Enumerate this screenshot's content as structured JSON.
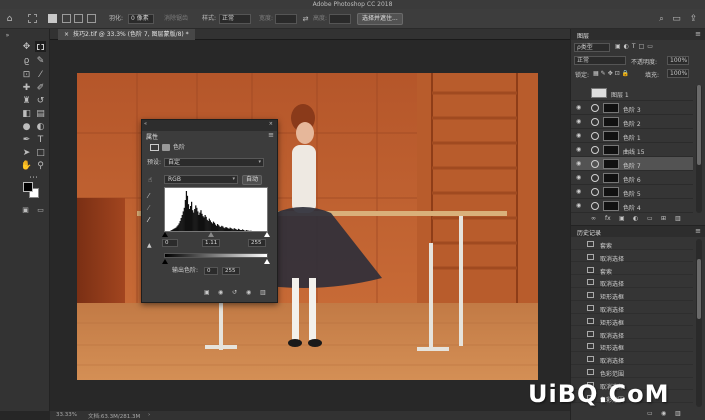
{
  "app": {
    "title": "Adobe Photoshop CC 2018"
  },
  "options_bar": {
    "feather_label": "羽化:",
    "feather_value": "0 像素",
    "antialias_label": "消除锯齿",
    "style_label": "样式:",
    "style_value": "正常",
    "width_label": "宽度:",
    "height_label": "高度:",
    "select_mask_button": "选择并遮住..."
  },
  "document": {
    "tab_title": "技巧2.tif @ 33.3% (色阶 7, 图层蒙版/8) *"
  },
  "status_bar": {
    "zoom": "33.33%",
    "doc_info": "文档:63.3M/281.3M"
  },
  "properties": {
    "title": "属性",
    "adjustment_name": "色阶",
    "preset_label": "预设:",
    "preset_value": "自定",
    "channel_value": "RGB",
    "auto_button": "自动",
    "input_black": "0",
    "input_gamma": "1.11",
    "input_white": "255",
    "output_label": "输出色阶:",
    "output_black": "0",
    "output_white": "255",
    "histogram": [
      1,
      1,
      2,
      2,
      3,
      4,
      5,
      6,
      7,
      8,
      9,
      11,
      13,
      16,
      20,
      25,
      30,
      36,
      42,
      55,
      70,
      62,
      48,
      40,
      45,
      52,
      38,
      34,
      40,
      46,
      42,
      36,
      30,
      34,
      38,
      32,
      28,
      26,
      30,
      27,
      22,
      20,
      24,
      21,
      18,
      16,
      19,
      17,
      14,
      12,
      15,
      13,
      11,
      10,
      12,
      11,
      9,
      8,
      10,
      9,
      8,
      7,
      9,
      8,
      7,
      6,
      8,
      7,
      6,
      5,
      7,
      6,
      5,
      5,
      6,
      5,
      4,
      4,
      5,
      4,
      4,
      3,
      4,
      3,
      3,
      3,
      3,
      2,
      3,
      2,
      2,
      2,
      2,
      2,
      1,
      2,
      1,
      1,
      1,
      1
    ]
  },
  "layers": {
    "title": "图层",
    "kind_label": "ρ类型",
    "blend_mode": "正常",
    "opacity_label": "不透明度:",
    "opacity_value": "100%",
    "lock_label": "锁定:",
    "fill_label": "填充:",
    "fill_value": "100%",
    "group_name": "图层 1",
    "items": [
      {
        "name": "色阶 3"
      },
      {
        "name": "色阶 2"
      },
      {
        "name": "色阶 1"
      },
      {
        "name": "曲线 15"
      },
      {
        "name": "色阶 7"
      },
      {
        "name": "色阶 6"
      },
      {
        "name": "色阶 5"
      },
      {
        "name": "色阶 4"
      }
    ],
    "footer_fx": "fx"
  },
  "history": {
    "title": "历史记录",
    "items": [
      {
        "name": "套索"
      },
      {
        "name": "取消选择"
      },
      {
        "name": "套索"
      },
      {
        "name": "取消选择"
      },
      {
        "name": "矩形选框"
      },
      {
        "name": "取消选择"
      },
      {
        "name": "矩形选框"
      },
      {
        "name": "取消选择"
      },
      {
        "name": "矩形选框"
      },
      {
        "name": "取消选择"
      },
      {
        "name": "色彩范围"
      },
      {
        "name": "取消选择"
      },
      {
        "name": "色彩范围"
      }
    ]
  },
  "watermark": "UiBQ.CoM",
  "colors": {
    "ui_dark": "#262626",
    "panel": "#353535",
    "selected": "#535353",
    "accent": "#2d7bd4"
  }
}
